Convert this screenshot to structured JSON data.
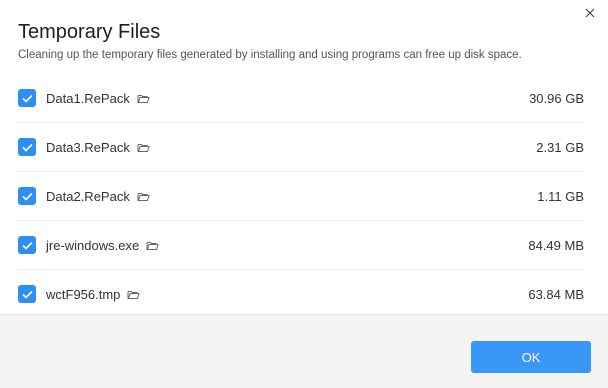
{
  "dialog": {
    "title": "Temporary Files",
    "subtitle": "Cleaning up the temporary files generated by installing and using programs can free up disk space.",
    "close_icon": "close-icon",
    "ok_label": "OK",
    "accent_color": "#2f8ef5"
  },
  "files": [
    {
      "name": "Data1.RePack",
      "size": "30.96 GB",
      "checked": true
    },
    {
      "name": "Data3.RePack",
      "size": "2.31 GB",
      "checked": true
    },
    {
      "name": "Data2.RePack",
      "size": "1.11 GB",
      "checked": true
    },
    {
      "name": "jre-windows.exe",
      "size": "84.49 MB",
      "checked": true
    },
    {
      "name": "wctF956.tmp",
      "size": "63.84 MB",
      "checked": true
    }
  ]
}
